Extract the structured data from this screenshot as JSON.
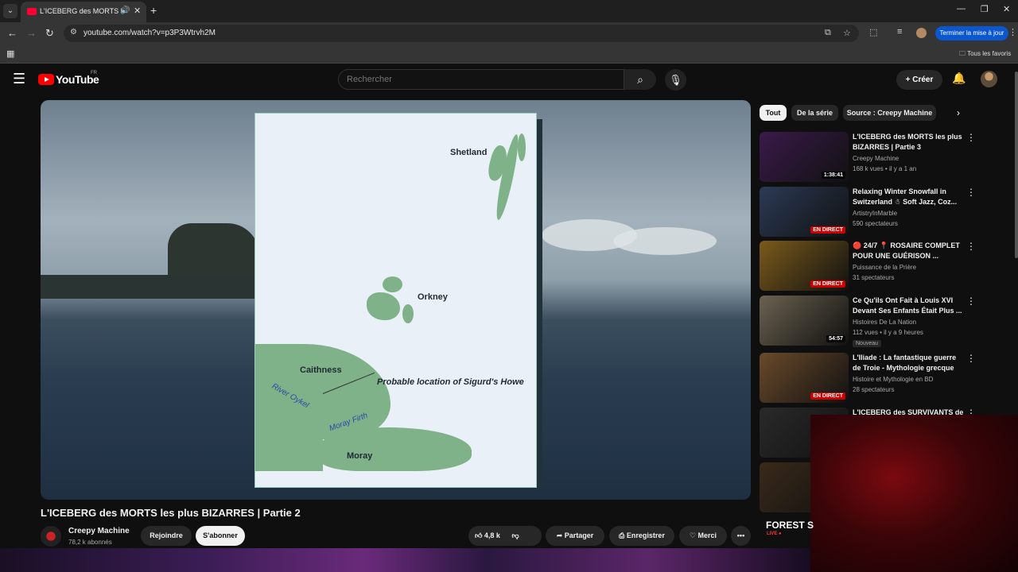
{
  "browser": {
    "tab_title": "L'ICEBERG des MORTS les plus BIZARRES | Partie 2",
    "url": "youtube.com/watch?v=p3P3Wtrvh2M",
    "update_button": "Terminer la mise à jour",
    "bookmarks_folder": "Tous les favoris"
  },
  "header": {
    "logo_text": "YouTube",
    "country": "FR",
    "search_placeholder": "Rechercher",
    "create_label": "Créer"
  },
  "map": {
    "labels": {
      "shetland": "Shetland",
      "orkney": "Orkney",
      "caithness": "Caithness",
      "moray": "Moray",
      "location": "Probable location of Sigurd's Howe",
      "river": "River Oykel",
      "firth": "Moray Firth"
    }
  },
  "video": {
    "title": "L'ICEBERG des MORTS les plus BIZARRES | Partie 2",
    "channel": "Creepy Machine",
    "subscribers": "78,2 k abonnés",
    "join_label": "Rejoindre",
    "subscribe_label": "S'abonner",
    "likes": "4,8 k",
    "share_label": "Partager",
    "save_label": "Enregistrer",
    "thanks_label": "Merci",
    "more": "•••"
  },
  "chips": [
    "Tout",
    "De la série",
    "Source : Creepy Machine"
  ],
  "recommendations": [
    {
      "title": "L'ICEBERG des MORTS les plus BIZARRES | Partie 3",
      "channel": "Creepy Machine",
      "meta": "168 k vues • il y a 1 an",
      "badge": "1:38:41",
      "live": false,
      "is_new": "",
      "thumb_color": "#3a1a4a"
    },
    {
      "title": "Relaxing Winter Snowfall in Switzerland ☃ Soft Jazz, Coz...",
      "channel": "ArtistryInMarble",
      "meta": "590 spectateurs",
      "badge": "EN DIRECT",
      "live": true,
      "is_new": "",
      "thumb_color": "#2b3a55"
    },
    {
      "title": "🔴 24/7 📍 ROSAIRE COMPLET POUR UNE GUÉRISON ...",
      "channel": "Puissance de la Prière",
      "meta": "31 spectateurs",
      "badge": "EN DIRECT",
      "live": true,
      "is_new": "",
      "thumb_color": "#7a5a1a"
    },
    {
      "title": "Ce Qu'ils Ont Fait à Louis XVI Devant Ses Enfants Était Plus ...",
      "channel": "Histoires De La Nation",
      "meta": "112 vues • il y a 9 heures",
      "badge": "54:57",
      "live": false,
      "is_new": "Nouveau",
      "thumb_color": "#6b6250"
    },
    {
      "title": "L'Iliade : La fantastique guerre de Troie - Mythologie grecque",
      "channel": "Histoire et Mythologie en BD",
      "meta": "28 spectateurs",
      "badge": "EN DIRECT",
      "live": true,
      "is_new": "",
      "thumb_color": "#6a4a2a"
    },
    {
      "title": "L'ICEBERG des SURVIVANTS de",
      "channel": "",
      "meta": "",
      "badge": "",
      "live": false,
      "is_new": "",
      "thumb_color": "#2a2a2a"
    },
    {
      "title": "",
      "channel": "",
      "meta": "",
      "badge": "",
      "live": false,
      "is_new": "",
      "thumb_color": "#3a2a1a"
    }
  ],
  "forest_label": "FOREST S",
  "live_mini": "LIVE ●"
}
